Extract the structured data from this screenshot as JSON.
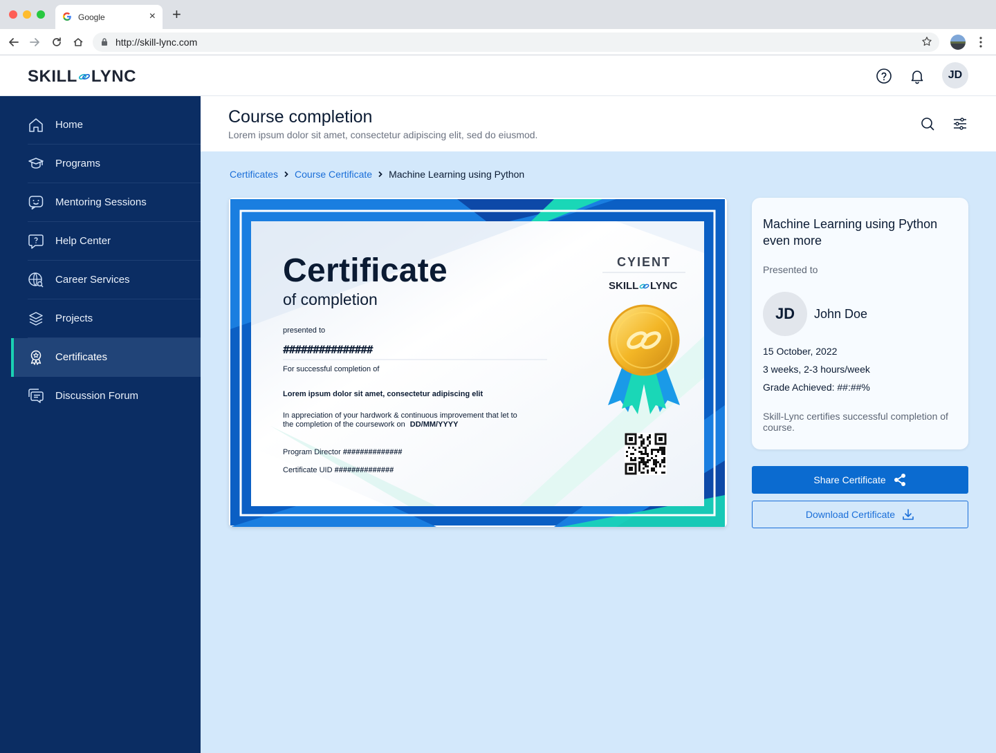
{
  "browser": {
    "tab_title": "Google",
    "url": "http://skill-lync.com",
    "new_tab_symbol": "+",
    "close_symbol": "×"
  },
  "header": {
    "logo_left": "SKILL",
    "logo_right": "LYNC",
    "avatar_initials": "JD"
  },
  "sidebar": {
    "items": [
      {
        "label": "Home",
        "icon": "home-icon"
      },
      {
        "label": "Programs",
        "icon": "graduation-cap-icon"
      },
      {
        "label": "Mentoring Sessions",
        "icon": "chat-smile-icon"
      },
      {
        "label": "Help Center",
        "icon": "help-bubble-icon"
      },
      {
        "label": "Career Services",
        "icon": "globe-search-icon"
      },
      {
        "label": "Projects",
        "icon": "layers-icon"
      },
      {
        "label": "Certificates",
        "icon": "award-icon",
        "active": true
      },
      {
        "label": "Discussion Forum",
        "icon": "forum-icon"
      }
    ]
  },
  "page": {
    "title": "Course completion",
    "subtitle": "Lorem ipsum dolor sit amet, consectetur adipiscing elit, sed do eiusmod."
  },
  "breadcrumb": {
    "items": [
      "Certificates",
      "Course Certificate",
      "Machine Learning using Python"
    ]
  },
  "certificate": {
    "heading": "Certificate",
    "subheading": "of completion",
    "presented_to_label": "presented to",
    "recipient": "###############",
    "completion_label": "For successful completion of",
    "course": "Lorem ipsum dolor sit amet, consectetur adipiscing elit",
    "appreciation_line1": "In appreciation of your hardwork & continuous improvement that let to",
    "appreciation_line2": "the completion of the coursework on",
    "date_placeholder": "DD/MM/YYYY",
    "director_label": "Program Director",
    "director_value": "##############",
    "uid_label": "Certificate UID",
    "uid_value": "##############",
    "partner_logo": "CYIENT",
    "brand_left": "SKILL",
    "brand_right": "LYNC"
  },
  "info_card": {
    "title": "Machine Learning using Python even more",
    "presented_to": "Presented to",
    "avatar_initials": "JD",
    "name": "John Doe",
    "date": "15 October, 2022",
    "duration": "3 weeks, 2-3 hours/week",
    "grade": "Grade Achieved: ##:##%",
    "footer": "Skill-Lync certifies successful completion of course."
  },
  "actions": {
    "share_label": "Share Certificate",
    "download_label": "Download Certificate"
  },
  "colors": {
    "sidebar_bg": "#0b2d63",
    "active_item_bg": "#214478",
    "active_accent": "#1ad1b3",
    "primary": "#0b6bd0",
    "link": "#1a6ed8",
    "page_bg": "#d3e8fb"
  }
}
